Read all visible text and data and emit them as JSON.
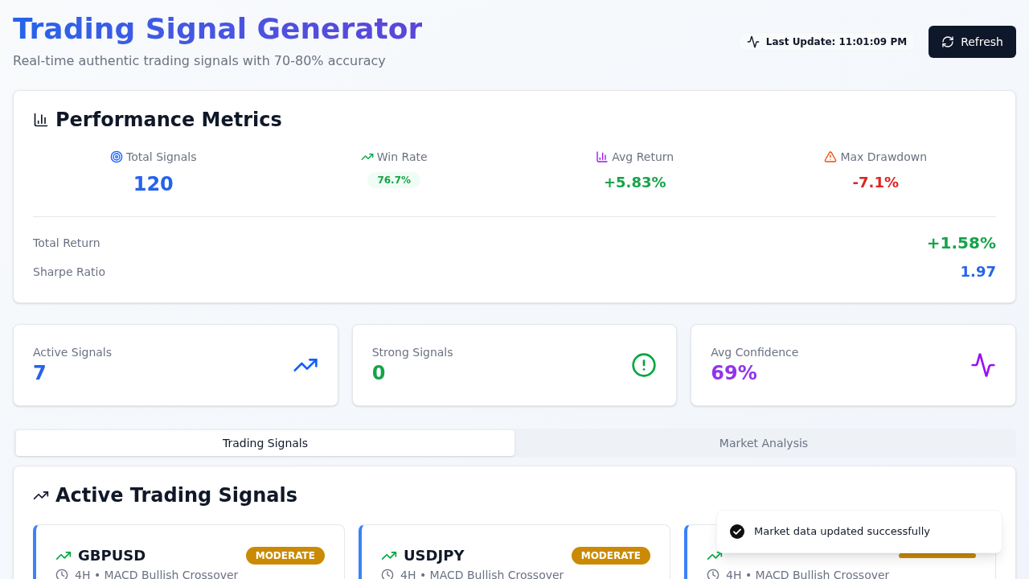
{
  "header": {
    "title": "Trading Signal Generator",
    "subtitle": "Real-time authentic trading signals with 70-80% accuracy",
    "last_update": "Last Update: 11:01:09 PM",
    "refresh_button": "Refresh"
  },
  "performance": {
    "title": "Performance Metrics",
    "metrics": [
      {
        "label": "Total Signals",
        "value": "120",
        "kind": "number",
        "color": "#2563eb"
      },
      {
        "label": "Win Rate",
        "value": "76.7%",
        "kind": "badge",
        "color": "#16a34a"
      },
      {
        "label": "Avg Return",
        "value": "+5.83%",
        "kind": "text",
        "color": "#16a34a"
      },
      {
        "label": "Max Drawdown",
        "value": "-7.1%",
        "kind": "text",
        "color": "#dc2626"
      }
    ],
    "summary": [
      {
        "label": "Total Return",
        "value": "+1.58%",
        "color": "#16a34a"
      },
      {
        "label": "Sharpe Ratio",
        "value": "1.97",
        "color": "#2563eb"
      }
    ]
  },
  "stats": [
    {
      "label": "Active Signals",
      "value": "7",
      "color": "#2563eb"
    },
    {
      "label": "Strong Signals",
      "value": "0",
      "color": "#16a34a"
    },
    {
      "label": "Avg Confidence",
      "value": "69%",
      "color": "#9333ea"
    }
  ],
  "tabs": [
    {
      "label": "Trading Signals",
      "selected": true
    },
    {
      "label": "Market Analysis",
      "selected": false
    }
  ],
  "signals_panel": {
    "title": "Active Trading Signals",
    "signals": [
      {
        "symbol": "GBPUSD",
        "badge": "MODERATE",
        "detail": "4H • MACD Bullish Crossover"
      },
      {
        "symbol": "USDJPY",
        "badge": "MODERATE",
        "detail": "4H • MACD Bullish Crossover"
      },
      {
        "detail": "4H • MACD Bullish Crossover"
      }
    ]
  },
  "toast": {
    "message": "Market data updated successfully"
  }
}
